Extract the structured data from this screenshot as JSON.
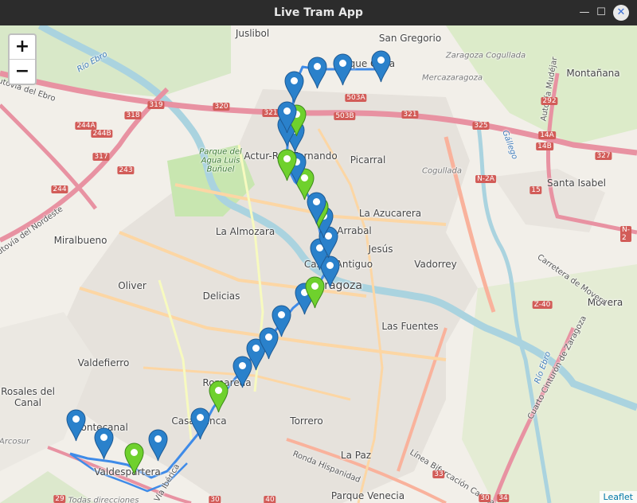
{
  "window": {
    "title": "Live Tram App",
    "minimize_glyph": "—",
    "maximize_glyph": "☐",
    "close_glyph": "✕"
  },
  "map": {
    "zoom_in_label": "+",
    "zoom_out_label": "−",
    "attribution": "Leaflet",
    "colors": {
      "route": "#3f8be8",
      "marker_blue": "#2a81cb",
      "marker_green": "#6fd12d"
    },
    "place_labels": [
      "Juslibol",
      "San Gregorio",
      "Parque Goya",
      "Zaragoza Cogullada",
      "Mercazaragoza",
      "Montañana",
      "Picarral",
      "Cogullada",
      "Actur-Rey Fernando",
      "Parque del Agua Luis Buñuel",
      "Santa Isabel",
      "La Azucarera",
      "La Almozara",
      "Arrabal",
      "Jesús",
      "Miralbueno",
      "Casco Antiguo",
      "Vadorrey",
      "Oliver",
      "Zaragoza",
      "Delicias",
      "Movera",
      "Las Fuentes",
      "Valdefierro",
      "Romareda",
      "Rosales del Canal",
      "Casablanca",
      "Torrero",
      "Montecanal",
      "Valdespartera",
      "La Paz",
      "Parque Venecia",
      "Arcosur",
      "Todas direcciones",
      "Río Ebro",
      "Ronda Hispanidad",
      "Autovía del Ebro",
      "Autovía del Nordeste",
      "Carretera de Movera",
      "Cuarto Cinturón de Zaragoza",
      "Línea Bifurcación Casetas",
      "Vía Ibérica",
      "Autovía Mudéjar",
      "Gállego",
      "Río Ebro"
    ],
    "road_numbers": [
      "319",
      "320",
      "321",
      "503A",
      "503B",
      "321",
      "325",
      "318",
      "244A",
      "244B",
      "317",
      "243",
      "244",
      "14A",
      "14B",
      "327",
      "292",
      "N-2A",
      "15",
      "N-2",
      "Z-40",
      "29",
      "30",
      "40",
      "33",
      "30",
      "34"
    ]
  }
}
